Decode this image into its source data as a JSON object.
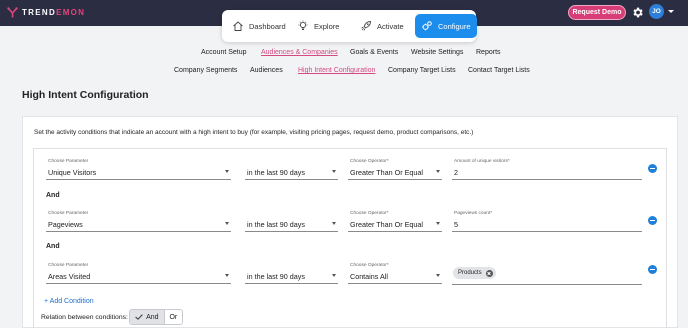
{
  "brand": {
    "name_part1": "TREND",
    "name_part2": "EMON",
    "accent": "#e0457b"
  },
  "header": {
    "request_demo_label": "Request Demo",
    "user_initials": "JO"
  },
  "main_nav": [
    {
      "label": "Dashboard",
      "icon": "home-icon"
    },
    {
      "label": "Explore",
      "icon": "lightbulb-icon"
    },
    {
      "label": "Activate",
      "icon": "rocket-icon"
    },
    {
      "label": "Configure",
      "icon": "gears-icon",
      "active": true
    }
  ],
  "config_tabs": [
    {
      "label": "Account Setup"
    },
    {
      "label": "Audiences & Companies",
      "active": true
    },
    {
      "label": "Goals & Events"
    },
    {
      "label": "Website Settings"
    },
    {
      "label": "Reports"
    }
  ],
  "sub_tabs": [
    {
      "label": "Company Segments"
    },
    {
      "label": "Audiences"
    },
    {
      "label": "High Intent Configuration",
      "active": true
    },
    {
      "label": "Company Target Lists"
    },
    {
      "label": "Contact Target Lists"
    }
  ],
  "page_title": "High Intent Configuration",
  "intro_text": "Set the activity conditions that indicate an account with a high intent to buy (for example, visiting pricing pages, request demo, product comparisons, etc.)",
  "conditions": [
    {
      "parameter_label": "Choose Parameter",
      "parameter": "Unique Visitors",
      "timeframe": "in the last 90 days",
      "operator_label": "Choose Operator*",
      "operator": "Greater Than Or Equal",
      "value_label": "Amount of unique visitors*",
      "value": "2"
    },
    {
      "parameter_label": "Choose Parameter",
      "parameter": "Pageviews",
      "timeframe": "in the last 90 days",
      "operator_label": "Choose Operator*",
      "operator": "Greater Than Or Equal",
      "value_label": "Pageviews count*",
      "value": "5"
    },
    {
      "parameter_label": "Choose Parameter",
      "parameter": "Areas Visited",
      "timeframe": "in the last 90 days",
      "operator_label": "Choose Operator*",
      "operator": "Contains All",
      "chip": "Products"
    }
  ],
  "and_label": "And",
  "add_condition_label": "+ Add Condition",
  "relation": {
    "label": "Relation between conditions:",
    "and": "And",
    "or": "Or",
    "selected": "And"
  },
  "colors": {
    "topbar": "#2b2d42",
    "primary": "#1d8ded",
    "pink": "#d73d76"
  }
}
